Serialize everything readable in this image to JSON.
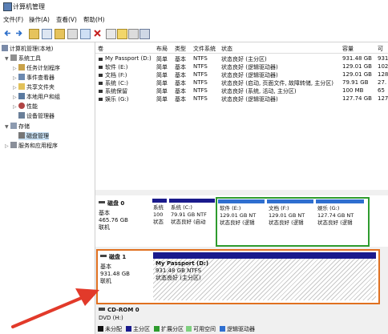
{
  "window": {
    "title": "计算机管理"
  },
  "menu": [
    "文件(F)",
    "操作(A)",
    "查看(V)",
    "帮助(H)"
  ],
  "tree": {
    "root": "计算机管理(本地)",
    "system_tools": "系统工具",
    "system_children": [
      "任务计划程序",
      "事件查看器",
      "共享文件夹",
      "本地用户和组",
      "性能",
      "设备管理器"
    ],
    "storage": "存储",
    "disk_mgmt": "磁盘管理",
    "services": "服务和应用程序"
  },
  "volume_table": {
    "headers": [
      "卷",
      "布局",
      "类型",
      "文件系统",
      "状态",
      "容量",
      "可"
    ],
    "rows": [
      [
        "My Passport (D:)",
        "简单",
        "基本",
        "NTFS",
        "状态良好 (主分区)",
        "931.48 GB",
        "931"
      ],
      [
        "软件 (E:)",
        "简单",
        "基本",
        "NTFS",
        "状态良好 (逻辑驱动器)",
        "129.01 GB",
        "102"
      ],
      [
        "文档 (F:)",
        "简单",
        "基本",
        "NTFS",
        "状态良好 (逻辑驱动器)",
        "129.01 GB",
        "128"
      ],
      [
        "系统 (C:)",
        "简单",
        "基本",
        "NTFS",
        "状态良好 (启动, 页面文件, 故障转储, 主分区)",
        "79.91 GB",
        "27."
      ],
      [
        "系统保留",
        "简单",
        "基本",
        "NTFS",
        "状态良好 (系统, 活动, 主分区)",
        "100 MB",
        "65"
      ],
      [
        "娱乐 (G:)",
        "简单",
        "基本",
        "NTFS",
        "状态良好 (逻辑驱动器)",
        "127.74 GB",
        "127"
      ]
    ]
  },
  "disk0": {
    "title": "磁盘 0",
    "type": "基本",
    "size": "465.76 GB",
    "status": "联机",
    "partitions": [
      {
        "lines": [
          "系统",
          "100",
          "状态"
        ]
      },
      {
        "lines": [
          "系统 (C:)",
          "79.91 GB NTF",
          "状态良好 (启动"
        ]
      },
      {
        "lines": [
          "软件 (E:)",
          "129.01 GB NT",
          "状态良好 (逻辑"
        ]
      },
      {
        "lines": [
          "文档 (F:)",
          "129.01 GB NT",
          "状态良好 (逻辑"
        ]
      },
      {
        "lines": [
          "娱乐 (G:)",
          "127.74 GB NT",
          "状态良好 (逻辑"
        ]
      }
    ]
  },
  "disk1": {
    "title": "磁盘 1",
    "type": "基本",
    "size": "931.48 GB",
    "status": "联机",
    "partition": {
      "name": "My Passport (D:)",
      "size": "931.48 GB NTFS",
      "status": "状态良好 (主分区)"
    }
  },
  "cdrom": {
    "title": "CD-ROM 0",
    "type": "DVD (H:)"
  },
  "legend": [
    "未分配",
    "主分区",
    "扩展分区",
    "可用空间",
    "逻辑驱动器"
  ],
  "colors": {
    "primary": "#1a1a8c",
    "logical": "#2f6fd0",
    "extended": "#2e9b2e",
    "free": "#7fd07f",
    "unalloc": "#111111",
    "highlight": "#e07020",
    "arrow": "#e23a2a"
  }
}
